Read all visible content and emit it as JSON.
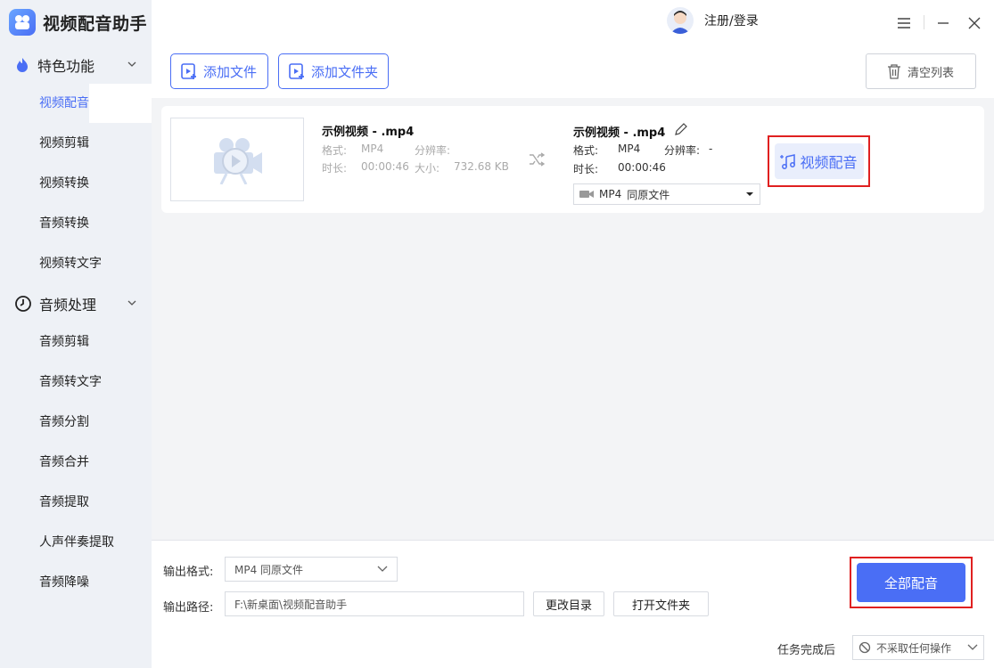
{
  "app": {
    "title": "视频配音助手"
  },
  "sidebar": {
    "section_featured": "特色功能",
    "featured_items": [
      "视频配音",
      "视频剪辑",
      "视频转换",
      "音频转换",
      "视频转文字"
    ],
    "section_audio": "音频处理",
    "audio_items": [
      "音频剪辑",
      "音频转文字",
      "音频分割",
      "音频合并",
      "音频提取",
      "人声伴奏提取",
      "音频降噪"
    ]
  },
  "header": {
    "login": "注册/登录"
  },
  "toolbar": {
    "add_file": "添加文件",
    "add_folder": "添加文件夹",
    "clear_list": "清空列表"
  },
  "file": {
    "source": {
      "name": "示例视频 - .mp4",
      "format_label": "格式:",
      "format_value": "MP4",
      "resolution_label": "分辨率:",
      "resolution_value": "",
      "duration_label": "时长:",
      "duration_value": "00:00:46",
      "size_label": "大小:",
      "size_value": "732.68 KB"
    },
    "output": {
      "name": "示例视频 - .mp4",
      "format_label": "格式:",
      "format_value": "MP4",
      "resolution_label": "分辨率:",
      "resolution_value": "-",
      "duration_label": "时长:",
      "duration_value": "00:00:46",
      "select_format": "MP4",
      "select_quality": "同原文件"
    },
    "dub_button": "视频配音"
  },
  "bottom": {
    "output_format_label": "输出格式:",
    "output_format_value": "MP4   同原文件",
    "output_path_label": "输出路径:",
    "output_path_value": "F:\\新桌面\\视频配音助手",
    "change_dir": "更改目录",
    "open_folder": "打开文件夹",
    "dub_all": "全部配音",
    "after_task_label": "任务完成后",
    "after_task_value": "不采取任何操作"
  },
  "colors": {
    "accent": "#4a6ef5",
    "highlight": "#e02020"
  }
}
